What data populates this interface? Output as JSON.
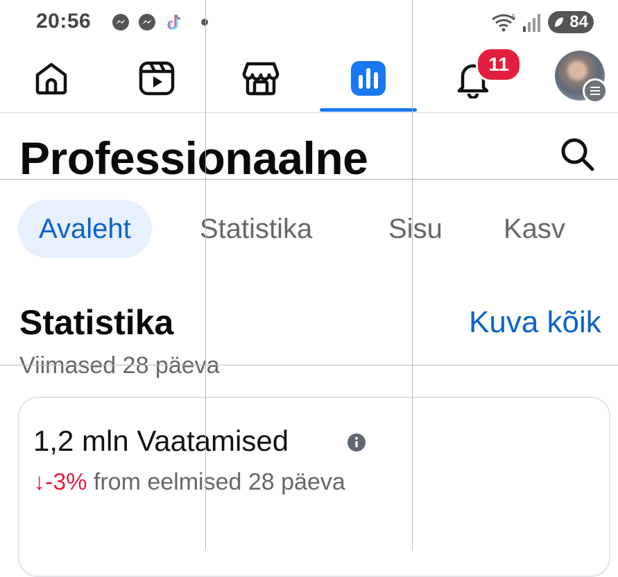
{
  "status_bar": {
    "time": "20:56",
    "icons": [
      "messenger-icon",
      "messenger-icon",
      "tiktok-icon"
    ],
    "battery": "84"
  },
  "nav": {
    "items": [
      "home-icon",
      "reels-icon",
      "marketplace-icon",
      "professional-dashboard-icon",
      "notifications-icon",
      "profile-avatar"
    ],
    "notification_count": "11",
    "accent": "#1877f2"
  },
  "header": {
    "title": "Professionaalne"
  },
  "tabs": [
    {
      "label": "Avaleht",
      "active": true
    },
    {
      "label": "Statistika"
    },
    {
      "label": "Sisu"
    },
    {
      "label": "Kasv"
    }
  ],
  "section": {
    "title": "Statistika",
    "view_all": "Kuva kõik",
    "subtitle": "Viimased 28 päeva"
  },
  "card": {
    "title": "1,2 mln Vaatamised",
    "delta": "↓-3%",
    "delta_suffix": " from eelmised 28 päeva",
    "delta_color": "#e41e3f"
  }
}
